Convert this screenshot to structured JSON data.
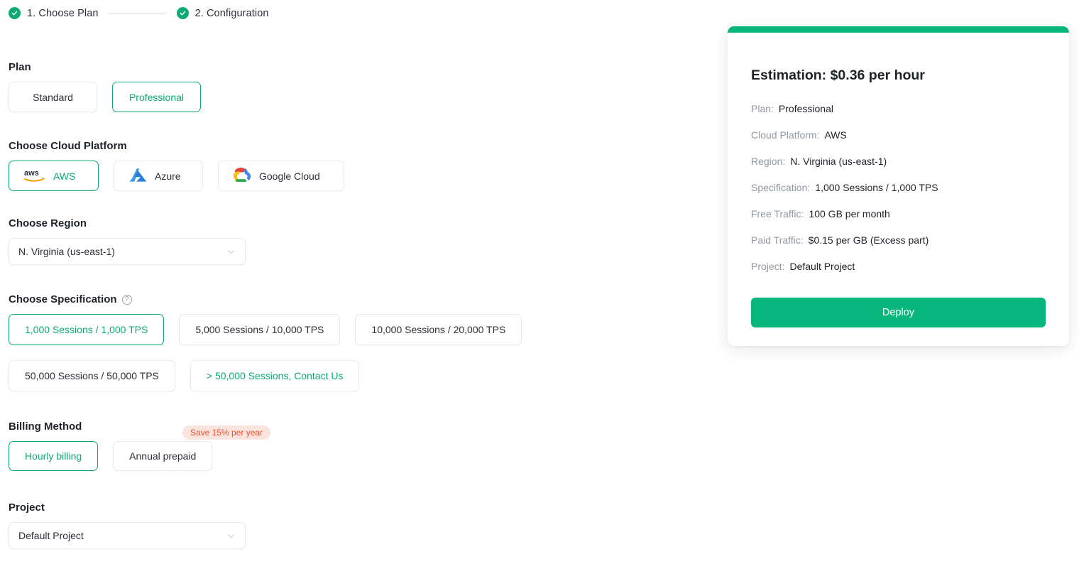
{
  "stepper": {
    "steps": [
      {
        "label": "1. Choose Plan",
        "icon": "check-circle-icon"
      },
      {
        "label": "2. Configuration",
        "icon": "check-circle-icon"
      }
    ]
  },
  "colors": {
    "accent_green": "#06B67C",
    "accent_green_dark": "#0BAB72",
    "badge_bg": "#FCE4DE",
    "badge_text": "#F0522F",
    "border": "#e8eaee"
  },
  "plan": {
    "title": "Plan",
    "options": [
      {
        "label": "Standard",
        "selected": false
      },
      {
        "label": "Professional",
        "selected": true
      }
    ]
  },
  "cloud_platform": {
    "title": "Choose Cloud Platform",
    "options": [
      {
        "label": "AWS",
        "icon": "aws-logo-icon",
        "selected": true
      },
      {
        "label": "Azure",
        "icon": "azure-logo-icon",
        "selected": false
      },
      {
        "label": "Google Cloud",
        "icon": "google-cloud-logo-icon",
        "selected": false
      }
    ]
  },
  "region": {
    "title": "Choose Region",
    "value": "N. Virginia (us-east-1)",
    "icon": "chevron-down-icon"
  },
  "specification": {
    "title": "Choose Specification",
    "help_icon": "help-circle-icon",
    "help_glyph": "?",
    "options": [
      {
        "label": "1,000 Sessions / 1,000 TPS",
        "selected": true,
        "link": false
      },
      {
        "label": "5,000 Sessions / 10,000 TPS",
        "selected": false,
        "link": false
      },
      {
        "label": "10,000 Sessions / 20,000 TPS",
        "selected": false,
        "link": false
      },
      {
        "label": "50,000 Sessions / 50,000 TPS",
        "selected": false,
        "link": false
      },
      {
        "label": "> 50,000 Sessions, Contact Us",
        "selected": false,
        "link": true
      }
    ]
  },
  "billing": {
    "title": "Billing Method",
    "badge": "Save 15% per year",
    "options": [
      {
        "label": "Hourly billing",
        "selected": true
      },
      {
        "label": "Annual prepaid",
        "selected": false
      }
    ]
  },
  "project": {
    "title": "Project",
    "value": "Default Project",
    "icon": "chevron-down-icon"
  },
  "summary": {
    "title": "Estimation: $0.36 per hour",
    "rows": [
      {
        "label": "Plan:",
        "value": "Professional"
      },
      {
        "label": "Cloud Platform:",
        "value": "AWS"
      },
      {
        "label": "Region:",
        "value": "N. Virginia (us-east-1)"
      },
      {
        "label": "Specification:",
        "value": "1,000 Sessions / 1,000 TPS"
      },
      {
        "label": "Free Traffic:",
        "value": "100 GB per month"
      },
      {
        "label": "Paid Traffic:",
        "value": "$0.15 per GB (Excess part)"
      },
      {
        "label": "Project:",
        "value": "Default Project"
      }
    ],
    "deploy_label": "Deploy"
  }
}
